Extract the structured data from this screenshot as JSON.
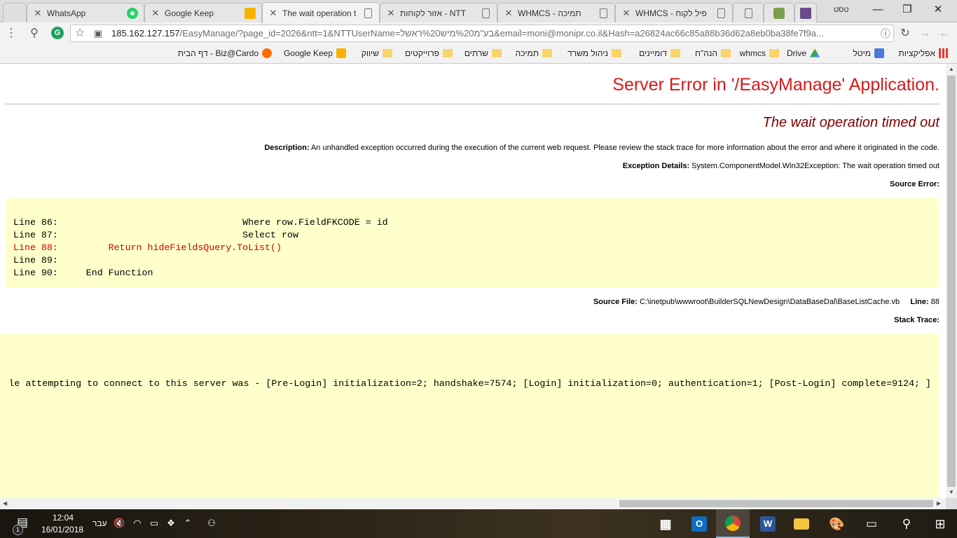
{
  "tabs": [
    {
      "title": "WhatsApp",
      "icon": "whatsapp-icon"
    },
    {
      "title": "Google Keep",
      "icon": "google-keep-icon"
    },
    {
      "title": "The wait operation t",
      "icon": "page-icon",
      "active": true
    },
    {
      "title": "אזור לקוחות - NTT",
      "icon": "page-icon"
    },
    {
      "title": "WHMCS - תמיכה",
      "icon": "page-icon"
    },
    {
      "title": "WHMCS - פיל לקוח",
      "icon": "page-icon"
    }
  ],
  "profile_name": "טסט",
  "window_controls": {
    "minimize": "—",
    "restore": "❐",
    "close": "✕"
  },
  "address_bar": {
    "url_host": "185.162.127.157",
    "url_path": "/EasyManage/?page_id=2026&ntt=1&NTTUserName=בע\"מ%20מיש%20ראשל&email=moni@monipr.co.il&Hash=a26824ac66c85a88b36d62a8eb0ba38fe7f9a..."
  },
  "bookmarks": [
    {
      "label": "אפליקציות",
      "icon": "apps-icon"
    },
    {
      "label": "מיטל",
      "icon": "docs-icon"
    },
    {
      "label": "Drive",
      "icon": "drive-icon"
    },
    {
      "label": "whmcs",
      "icon": "folder-icon"
    },
    {
      "label": "הנה\"ח",
      "icon": "folder-icon"
    },
    {
      "label": "דומיינים",
      "icon": "folder-icon"
    },
    {
      "label": "ניהול משרד",
      "icon": "folder-icon"
    },
    {
      "label": "תמיכה",
      "icon": "folder-icon"
    },
    {
      "label": "שרתים",
      "icon": "folder-icon"
    },
    {
      "label": "פרוייקטים",
      "icon": "folder-icon"
    },
    {
      "label": "שיווק",
      "icon": "folder-icon"
    },
    {
      "label": "Google Keep",
      "icon": "google-keep-icon"
    },
    {
      "label": "דף הבית - Biz@Cardo",
      "icon": "cardo-icon"
    }
  ],
  "error_page": {
    "title": "Server Error in '/EasyManage' Application.",
    "subtitle": "The wait operation timed out",
    "description_label": "Description:",
    "description_text": "An unhandled exception occurred during the execution of the current web request. Please review the stack trace for more information about the error and where it originated in the code.",
    "exception_label": "Exception Details:",
    "exception_text": "System.ComponentModel.Win32Exception: The wait operation timed out",
    "source_error_label": "Source Error:",
    "code_lines": [
      "Line 86:                                 Where row.FieldFKCODE = id",
      "Line 87:                                 Select row",
      "Line 88:         Return hideFieldsQuery.ToList()",
      "Line 89:",
      "Line 90:     End Function"
    ],
    "highlight_line_index": 2,
    "source_file_label": "Source File:",
    "source_file_path": "C:\\inetpub\\wwwroot\\BuilderSQLNewDesign\\DataBaseDal\\BaseListCache.vb",
    "line_label": "Line:",
    "line_number": "88",
    "stack_trace_label": "Stack Trace:",
    "stack_trace_text": "le attempting to connect to this server was - [Pre-Login] initialization=2; handshake=7574; [Login] initialization=0; authentication=1; [Post-Login] complete=9124; ]"
  },
  "taskbar": {
    "time": "12:04",
    "date": "16/01/2018",
    "language": "עבר",
    "notification_count": "1"
  }
}
